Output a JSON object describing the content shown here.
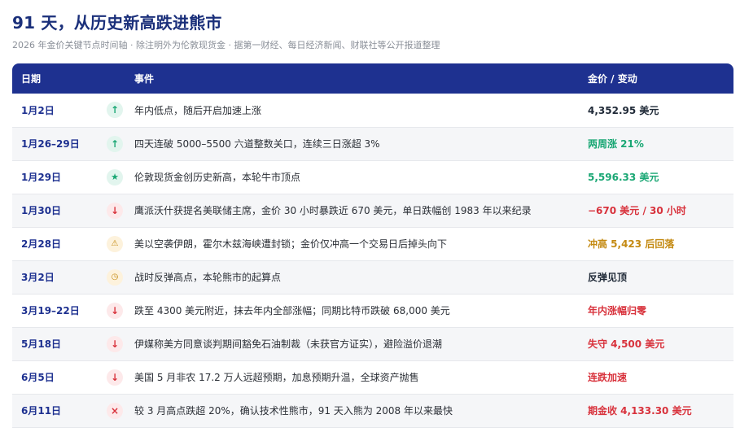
{
  "header": {
    "title": "91 天，从历史新高跌进熊市",
    "subtitle": "2026 年金价关键节点时间轴 · 除注明外为伦敦现货金 · 据第一财经、每日经济新闻、财联社等公开报道整理"
  },
  "table": {
    "columns": {
      "date": "日期",
      "event": "事件",
      "change": "金价 / 变动"
    },
    "colors": {
      "header_bg": "#1e3190",
      "green": "#1aa774",
      "red": "#d8323c",
      "amber": "#c48a12",
      "dark": "#1f2937"
    },
    "rows": [
      {
        "date": "1月2日",
        "icon": "↑",
        "icon_name": "arrow-up-icon",
        "icon_class": "icon-up",
        "event": "年内低点，随后开启加速上涨",
        "change": "4,352.95 美元",
        "tone": "tone-dark"
      },
      {
        "date": "1月26–29日",
        "icon": "↑",
        "icon_name": "arrow-up-icon",
        "icon_class": "icon-up",
        "event": "四天连破 5000–5500 六道整数关口，连续三日涨超 3%",
        "change": "两周涨 21%",
        "tone": "tone-green"
      },
      {
        "date": "1月29日",
        "icon": "★",
        "icon_name": "star-icon",
        "icon_class": "icon-star",
        "event": "伦敦现货金创历史新高，本轮牛市顶点",
        "change": "5,596.33 美元",
        "tone": "tone-green"
      },
      {
        "date": "1月30日",
        "icon": "↓",
        "icon_name": "arrow-down-icon",
        "icon_class": "icon-down",
        "event": "鹰派沃什获提名美联储主席，金价 30 小时暴跌近 670 美元，单日跌幅创 1983 年以来纪录",
        "change": "−670 美元 / 30 小时",
        "tone": "tone-red"
      },
      {
        "date": "2月28日",
        "icon": "⚠",
        "icon_name": "warning-icon",
        "icon_class": "icon-warn",
        "event": "美以空袭伊朗，霍尔木兹海峡遭封锁；金价仅冲高一个交易日后掉头向下",
        "change": "冲高 5,423 后回落",
        "tone": "tone-amber"
      },
      {
        "date": "3月2日",
        "icon": "◷",
        "icon_name": "clock-icon",
        "icon_class": "icon-clock",
        "event": "战时反弹高点，本轮熊市的起算点",
        "change": "反弹见顶",
        "tone": "tone-dark"
      },
      {
        "date": "3月19–22日",
        "icon": "↓",
        "icon_name": "arrow-down-icon",
        "icon_class": "icon-down",
        "event": "跌至 4300 美元附近，抹去年内全部涨幅；同期比特币跌破 68,000 美元",
        "change": "年内涨幅归零",
        "tone": "tone-red"
      },
      {
        "date": "5月18日",
        "icon": "↓",
        "icon_name": "arrow-down-icon",
        "icon_class": "icon-down",
        "event": "伊媒称美方同意谈判期间豁免石油制裁（未获官方证实），避险溢价退潮",
        "change": "失守 4,500 美元",
        "tone": "tone-red"
      },
      {
        "date": "6月5日",
        "icon": "↓",
        "icon_name": "arrow-down-icon",
        "icon_class": "icon-down",
        "event": "美国 5 月非农 17.2 万人远超预期，加息预期升温，全球资产抛售",
        "change": "连跌加速",
        "tone": "tone-red"
      },
      {
        "date": "6月11日",
        "icon": "×",
        "icon_name": "cross-icon",
        "icon_class": "icon-cross",
        "event": "较 3 月高点跌超 20%，确认技术性熊市，91 天入熊为 2008 年以来最快",
        "change": "期金收 4,133.30 美元",
        "tone": "tone-red"
      }
    ]
  }
}
